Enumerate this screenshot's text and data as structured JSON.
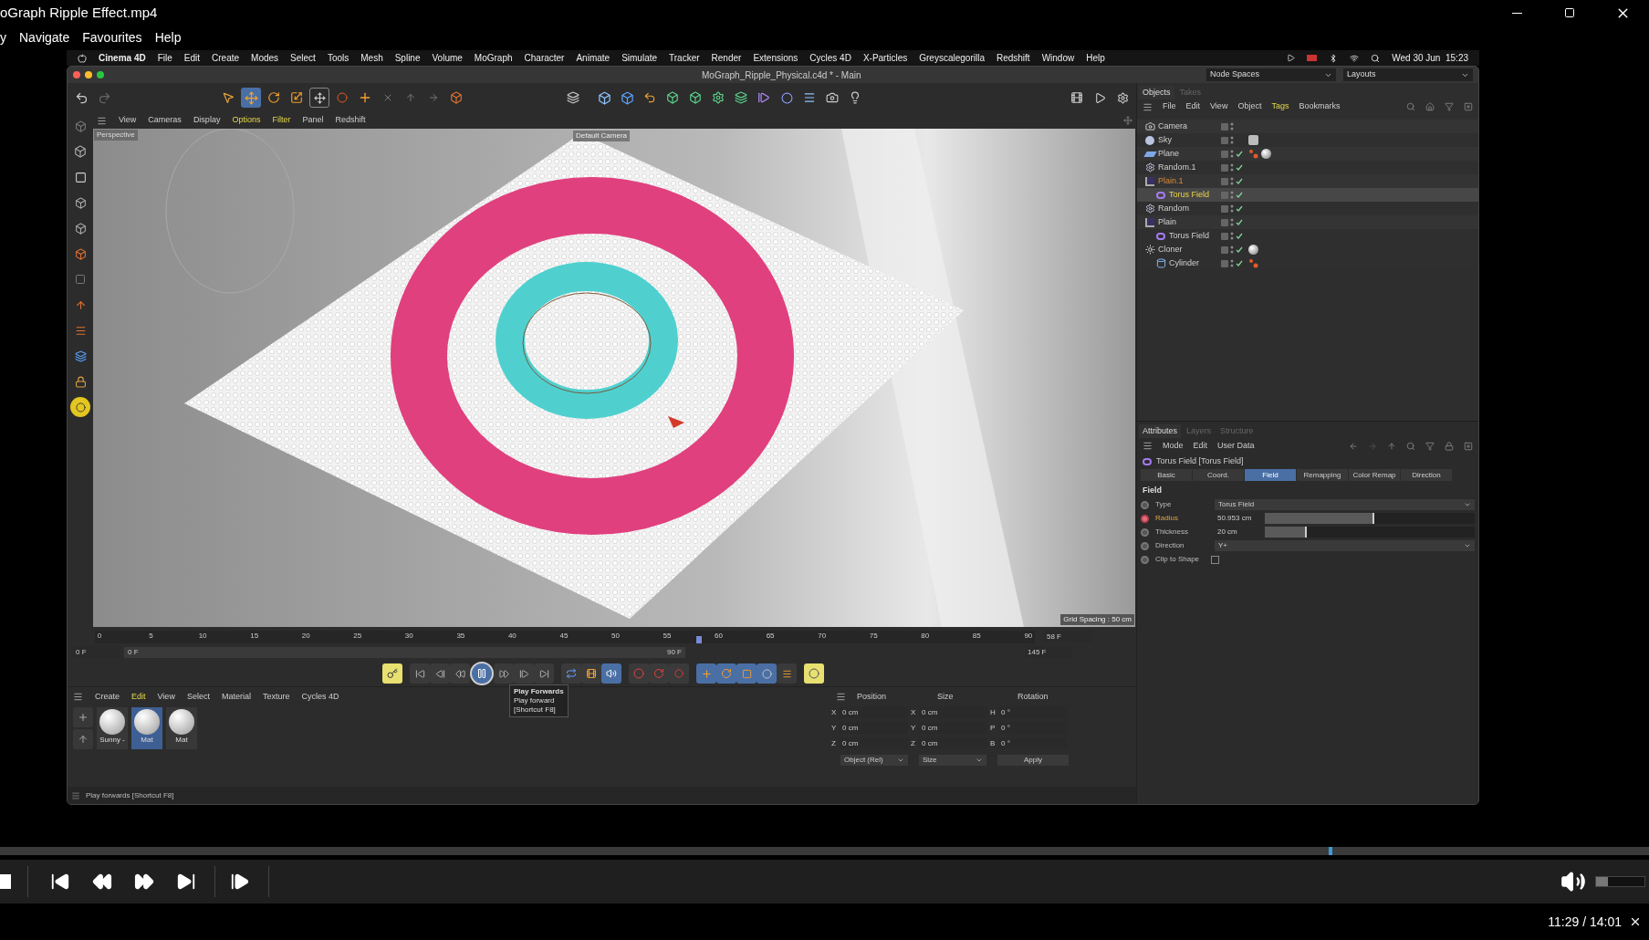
{
  "player": {
    "title": "oGraph Ripple Effect.mp4",
    "menu": [
      "y",
      "Navigate",
      "Favourites",
      "Help"
    ],
    "seek": {
      "level": 0.808
    },
    "volume": {
      "level": 0.25
    },
    "time": "11:29 / 14:01"
  },
  "mac_menubar": {
    "app": "Cinema 4D",
    "items": [
      "File",
      "Edit",
      "Create",
      "Modes",
      "Select",
      "Tools",
      "Mesh",
      "Spline",
      "Volume",
      "MoGraph",
      "Character",
      "Animate",
      "Simulate",
      "Tracker",
      "Render",
      "Extensions",
      "Cycles 4D",
      "X-Particles",
      "Greyscalegorilla",
      "Redshift",
      "Window",
      "Help"
    ],
    "clock": "Wed 30 Jun  15:23"
  },
  "c4d": {
    "window_title": "MoGraph_Ripple_Physical.c4d * - Main",
    "node_spaces": "Node Spaces",
    "layouts": "Layouts",
    "viewport": {
      "menu": [
        {
          "label": "View",
          "highlighted": false
        },
        {
          "label": "Cameras",
          "highlighted": false
        },
        {
          "label": "Display",
          "highlighted": false
        },
        {
          "label": "Options",
          "highlighted": true
        },
        {
          "label": "Filter",
          "highlighted": true
        },
        {
          "label": "Panel",
          "highlighted": false
        },
        {
          "label": "Redshift",
          "highlighted": false
        }
      ],
      "view_label": "Perspective",
      "camera": "Default Camera",
      "grid": "Grid Spacing : 50 cm"
    },
    "timeline": {
      "ticks": [
        "0",
        "5",
        "10",
        "15",
        "20",
        "25",
        "30",
        "35",
        "40",
        "45",
        "50",
        "55",
        "60",
        "65",
        "70",
        "75",
        "80",
        "85",
        "90"
      ],
      "playhead": {
        "level": 0.644
      },
      "current": "58 F",
      "start": "0 F",
      "range_start": "0 F",
      "range_end": "90 F",
      "end": "145 F"
    },
    "transport": {
      "playing": true
    },
    "tooltip": {
      "title": "Play Forwards",
      "lines": [
        "Play forward",
        "[Shortcut F8]"
      ]
    },
    "materials": {
      "menu": [
        {
          "label": "Create",
          "highlighted": false
        },
        {
          "label": "Edit",
          "highlighted": true
        },
        {
          "label": "View",
          "highlighted": false
        },
        {
          "label": "Select",
          "highlighted": false
        },
        {
          "label": "Material",
          "highlighted": false
        },
        {
          "label": "Texture",
          "highlighted": false
        },
        {
          "label": "Cycles 4D",
          "highlighted": false
        }
      ],
      "items": [
        {
          "name": "Sunny -",
          "selected": false
        },
        {
          "name": "Mat",
          "selected": true
        },
        {
          "name": "Mat",
          "selected": false
        }
      ]
    },
    "coordinates": {
      "headers": [
        "Position",
        "Size",
        "Rotation"
      ],
      "rows": [
        {
          "axis": "X",
          "position": "0 cm",
          "size_axis": "X",
          "size": "0 cm",
          "rot_axis": "H",
          "rotation": "0 °"
        },
        {
          "axis": "Y",
          "position": "0 cm",
          "size_axis": "Y",
          "size": "0 cm",
          "rot_axis": "P",
          "rotation": "0 °"
        },
        {
          "axis": "Z",
          "position": "0 cm",
          "size_axis": "Z",
          "size": "0 cm",
          "rot_axis": "B",
          "rotation": "0 °"
        }
      ],
      "mode": "Object (Rel)",
      "size_mode": "Size",
      "apply": "Apply"
    },
    "status": "Play forwards [Shortcut F8]"
  },
  "objects": {
    "tabs": [
      {
        "label": "Objects",
        "selected": true
      },
      {
        "label": "Takes",
        "selected": false
      }
    ],
    "menu": [
      {
        "label": "File",
        "highlighted": false
      },
      {
        "label": "Edit",
        "highlighted": false
      },
      {
        "label": "View",
        "highlighted": false
      },
      {
        "label": "Object",
        "highlighted": false
      },
      {
        "label": "Tags",
        "highlighted": true
      },
      {
        "label": "Bookmarks",
        "highlighted": false
      }
    ],
    "rows": [
      {
        "name": "Camera",
        "kind": "camera",
        "selected": false,
        "active": false,
        "checked": false
      },
      {
        "name": "Sky",
        "kind": "sky",
        "selected": false,
        "active": false,
        "checked": false,
        "tags": [
          {
            "kind": "sky"
          }
        ]
      },
      {
        "name": "Plane",
        "kind": "plane",
        "selected": false,
        "active": false,
        "checked": true,
        "tags": [
          {
            "kind": "phong"
          },
          {
            "kind": "material"
          }
        ]
      },
      {
        "name": "Random.1",
        "kind": "random",
        "selected": false,
        "active": false,
        "checked": true
      },
      {
        "name": "Plain.1",
        "kind": "plain",
        "selected": false,
        "active": true,
        "checked": true,
        "children": [
          {
            "name": "Torus Field",
            "kind": "torus",
            "selected": true,
            "active": false,
            "checked": true
          }
        ]
      },
      {
        "name": "Random",
        "kind": "random",
        "selected": false,
        "active": false,
        "checked": true
      },
      {
        "name": "Plain",
        "kind": "plain",
        "selected": false,
        "active": false,
        "checked": true,
        "children": [
          {
            "name": "Torus Field",
            "kind": "torus",
            "selected": false,
            "active": false,
            "checked": true
          }
        ]
      },
      {
        "name": "Cloner",
        "kind": "cloner",
        "selected": false,
        "active": false,
        "checked": true,
        "tags": [
          {
            "kind": "material"
          }
        ],
        "children": [
          {
            "name": "Cylinder",
            "kind": "cylinder",
            "selected": false,
            "active": false,
            "checked": true,
            "tags": [
              {
                "kind": "phong"
              }
            ]
          }
        ]
      }
    ]
  },
  "attributes": {
    "tabs": [
      {
        "label": "Attributes",
        "selected": true
      },
      {
        "label": "Layers",
        "selected": false
      },
      {
        "label": "Structure",
        "selected": false
      }
    ],
    "menu": [
      "Mode",
      "Edit",
      "User Data"
    ],
    "object": "Torus Field [Torus Field]",
    "param_tabs": [
      {
        "label": "Basic",
        "selected": false
      },
      {
        "label": "Coord.",
        "selected": false
      },
      {
        "label": "Field",
        "selected": true
      },
      {
        "label": "Remapping",
        "selected": false
      },
      {
        "label": "Color Remap",
        "selected": false
      },
      {
        "label": "Direction",
        "selected": false
      }
    ],
    "section": "Field",
    "params": [
      {
        "kind": "dropdown",
        "label": "Type",
        "value": "Torus Field",
        "keyed": false
      },
      {
        "kind": "slider",
        "label": "Radius",
        "value": "50.953 cm",
        "level": 0.52,
        "keyed": true
      },
      {
        "kind": "slider",
        "label": "Thickness",
        "value": "20 cm",
        "level": 0.2,
        "keyed": false
      },
      {
        "kind": "dropdown",
        "label": "Direction",
        "value": "Y+",
        "keyed": false
      },
      {
        "kind": "checkbox",
        "label": "Clip to Shape",
        "checked": false,
        "keyed": false
      }
    ]
  }
}
